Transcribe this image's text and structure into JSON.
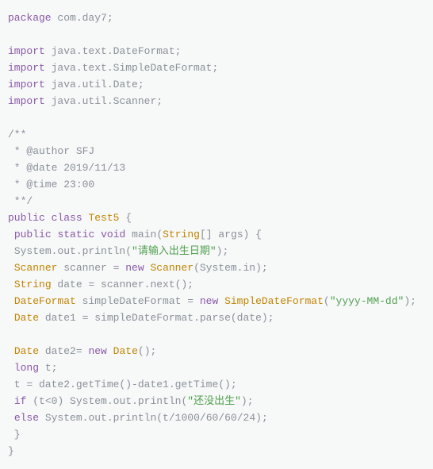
{
  "code": {
    "l0": {
      "kw1": "package",
      "sp": " ",
      "id": "com.day7",
      "semi": ";"
    },
    "blank1": "",
    "l1": {
      "kw": "import",
      "sp": " ",
      "id": "java.text.DateFormat",
      "semi": ";"
    },
    "l2": {
      "kw": "import",
      "sp": " ",
      "id": "java.text.SimpleDateFormat",
      "semi": ";"
    },
    "l3": {
      "kw": "import",
      "sp": " ",
      "id": "java.util.Date",
      "semi": ";"
    },
    "l4": {
      "kw": "import",
      "sp": " ",
      "id": "java.util.Scanner",
      "semi": ";"
    },
    "blank2": "",
    "l5": "/**",
    "l6": {
      "pre": " * ",
      "ann": "@author",
      "rest": " SFJ"
    },
    "l7": {
      "pre": " * ",
      "ann": "@date",
      "rest": " 2019/11/13"
    },
    "l8": {
      "pre": " * ",
      "ann": "@time",
      "rest": " 23:00"
    },
    "l9": " **/",
    "l10": {
      "kw1": "public",
      "sp1": " ",
      "kw2": "class",
      "sp2": " ",
      "typ": "Test5",
      "rest": " {"
    },
    "l11": {
      "pre": " ",
      "kw1": "public",
      "sp1": " ",
      "kw2": "static",
      "sp2": " ",
      "kw3": "void",
      "sp3": " ",
      "fn": "main",
      "open": "(",
      "typ": "String",
      "arr": "[] args",
      "close": ")",
      "rest": " {"
    },
    "l12": {
      "pre": " ",
      "call": "System.out.println(",
      "str": "\"请输入出生日期\"",
      "rest": ");"
    },
    "l13": {
      "pre": " ",
      "typ1": "Scanner",
      "mid": " scanner = ",
      "kw": "new",
      "sp": " ",
      "typ2": "Scanner",
      "rest": "(System.in);"
    },
    "l14": {
      "pre": " ",
      "typ": "String",
      "rest": " date = scanner.next();"
    },
    "l15": {
      "pre": " ",
      "typ1": "DateFormat",
      "mid": " simpleDateFormat = ",
      "kw": "new",
      "sp": " ",
      "typ2": "SimpleDateFormat",
      "open": "(",
      "str": "\"yyyy-MM-dd\"",
      "rest": ");"
    },
    "l16": {
      "pre": " ",
      "typ": "Date",
      "rest": " date1 = simpleDateFormat.parse(date);"
    },
    "blank3": "",
    "l17": {
      "pre": " ",
      "typ": "Date",
      "mid": " date2= ",
      "kw": "new",
      "sp": " ",
      "typ2": "Date",
      "rest": "();"
    },
    "l18": {
      "pre": " ",
      "kw": "long",
      "rest": " t;"
    },
    "l19": " t = date2.getTime()-date1.getTime();",
    "l20": {
      "pre": " ",
      "kw": "if",
      "mid": " (t<",
      "num": "0",
      "mid2": ") System.out.println(",
      "str": "\"还没出生\"",
      "rest": ");"
    },
    "l21": {
      "pre": " ",
      "kw": "else",
      "mid": " System.out.println(t/",
      "n1": "1000",
      "s1": "/",
      "n2": "60",
      "s2": "/",
      "n3": "60",
      "s3": "/",
      "n4": "24",
      "rest": ");"
    },
    "l22": " }",
    "l23": "}"
  }
}
